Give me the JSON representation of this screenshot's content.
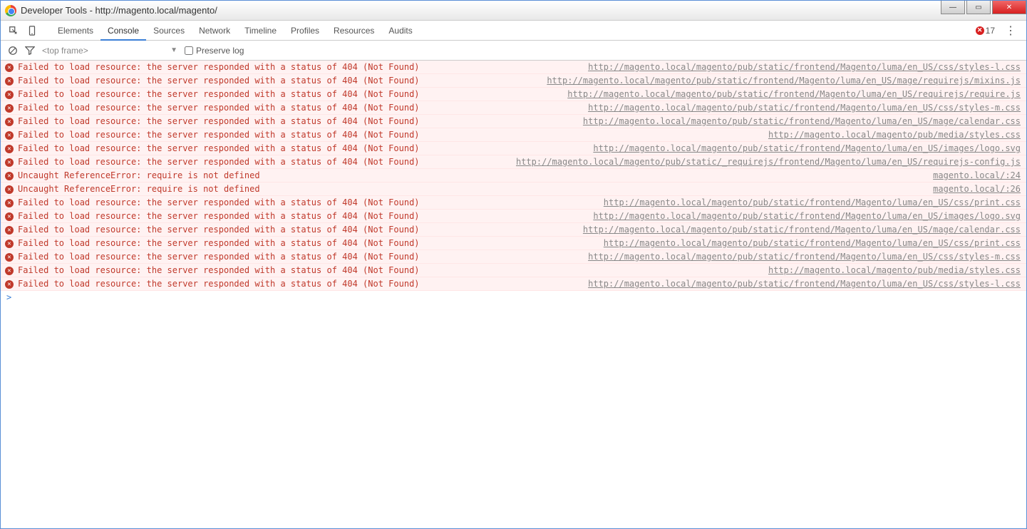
{
  "window": {
    "title": "Developer Tools - http://magento.local/magento/"
  },
  "tabs": [
    {
      "label": "Elements",
      "active": false
    },
    {
      "label": "Console",
      "active": true
    },
    {
      "label": "Sources",
      "active": false
    },
    {
      "label": "Network",
      "active": false
    },
    {
      "label": "Timeline",
      "active": false
    },
    {
      "label": "Profiles",
      "active": false
    },
    {
      "label": "Resources",
      "active": false
    },
    {
      "label": "Audits",
      "active": false
    }
  ],
  "error_count": "17",
  "frame_selector": "<top frame>",
  "preserve_log_label": "Preserve log",
  "preserve_log_checked": false,
  "prompt": ">",
  "log": [
    {
      "icon": "x",
      "msg": "Failed to load resource: the server responded with a status of 404 (Not Found)",
      "link": "http://magento.local/magento/pub/static/frontend/Magento/luma/en_US/css/styles-l.css"
    },
    {
      "icon": "x",
      "msg": "Failed to load resource: the server responded with a status of 404 (Not Found)",
      "link": "http://magento.local/magento/pub/static/frontend/Magento/luma/en_US/mage/requirejs/mixins.js"
    },
    {
      "icon": "x",
      "msg": "Failed to load resource: the server responded with a status of 404 (Not Found)",
      "link": "http://magento.local/magento/pub/static/frontend/Magento/luma/en_US/requirejs/require.js"
    },
    {
      "icon": "x",
      "msg": "Failed to load resource: the server responded with a status of 404 (Not Found)",
      "link": "http://magento.local/magento/pub/static/frontend/Magento/luma/en_US/css/styles-m.css"
    },
    {
      "icon": "x",
      "msg": "Failed to load resource: the server responded with a status of 404 (Not Found)",
      "link": "http://magento.local/magento/pub/static/frontend/Magento/luma/en_US/mage/calendar.css"
    },
    {
      "icon": "x",
      "msg": "Failed to load resource: the server responded with a status of 404 (Not Found)",
      "link": "http://magento.local/magento/pub/media/styles.css"
    },
    {
      "icon": "x",
      "msg": "Failed to load resource: the server responded with a status of 404 (Not Found)",
      "link": "http://magento.local/magento/pub/static/frontend/Magento/luma/en_US/images/logo.svg"
    },
    {
      "icon": "x",
      "msg": "Failed to load resource: the server responded with a status of 404 (Not Found)",
      "link": "http://magento.local/magento/pub/static/_requirejs/frontend/Magento/luma/en_US/requirejs-config.js"
    },
    {
      "icon": "x",
      "msg": "Uncaught ReferenceError: require is not defined",
      "link": "magento.local/:24"
    },
    {
      "icon": "x",
      "msg": "Uncaught ReferenceError: require is not defined",
      "link": "magento.local/:26"
    },
    {
      "icon": "x",
      "msg": "Failed to load resource: the server responded with a status of 404 (Not Found)",
      "link": "http://magento.local/magento/pub/static/frontend/Magento/luma/en_US/css/print.css"
    },
    {
      "icon": "x",
      "msg": "Failed to load resource: the server responded with a status of 404 (Not Found)",
      "link": "http://magento.local/magento/pub/static/frontend/Magento/luma/en_US/images/logo.svg"
    },
    {
      "icon": "x",
      "msg": "Failed to load resource: the server responded with a status of 404 (Not Found)",
      "link": "http://magento.local/magento/pub/static/frontend/Magento/luma/en_US/mage/calendar.css"
    },
    {
      "icon": "x",
      "msg": "Failed to load resource: the server responded with a status of 404 (Not Found)",
      "link": "http://magento.local/magento/pub/static/frontend/Magento/luma/en_US/css/print.css"
    },
    {
      "icon": "x",
      "msg": "Failed to load resource: the server responded with a status of 404 (Not Found)",
      "link": "http://magento.local/magento/pub/static/frontend/Magento/luma/en_US/css/styles-m.css"
    },
    {
      "icon": "x",
      "msg": "Failed to load resource: the server responded with a status of 404 (Not Found)",
      "link": "http://magento.local/magento/pub/media/styles.css"
    },
    {
      "icon": "x",
      "msg": "Failed to load resource: the server responded with a status of 404 (Not Found)",
      "link": "http://magento.local/magento/pub/static/frontend/Magento/luma/en_US/css/styles-l.css"
    }
  ]
}
